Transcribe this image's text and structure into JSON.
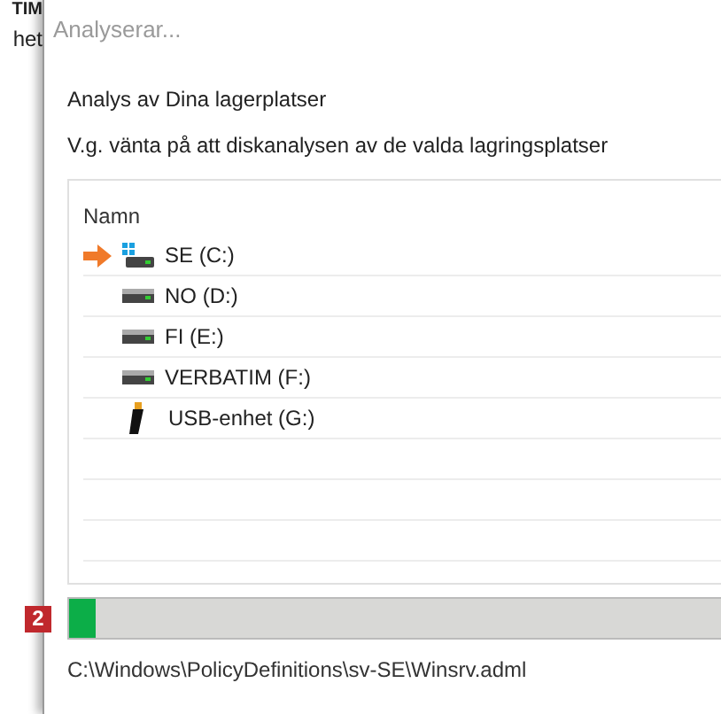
{
  "background_window": {
    "texts": [
      "TIM",
      "het"
    ]
  },
  "dialog": {
    "title": "Analyserar...",
    "heading": "Analys av Dina lagerplatser",
    "message": "V.g. vänta på att diskanalysen av de valda lagringsplatser",
    "list": {
      "column": "Namn",
      "rows": [
        {
          "kind": "system",
          "label": "SE (C:)",
          "current": true
        },
        {
          "kind": "disk",
          "label": "NO (D:)",
          "current": false
        },
        {
          "kind": "disk",
          "label": "FI (E:)",
          "current": false
        },
        {
          "kind": "disk",
          "label": "VERBATIM (F:)",
          "current": false
        },
        {
          "kind": "usb",
          "label": "USB-enhet (G:)",
          "current": false
        }
      ]
    },
    "step_badge": "2",
    "progress": {
      "level": 0.04
    },
    "current_file": "C:\\Windows\\PolicyDefinitions\\sv-SE\\Winsrv.adml"
  }
}
